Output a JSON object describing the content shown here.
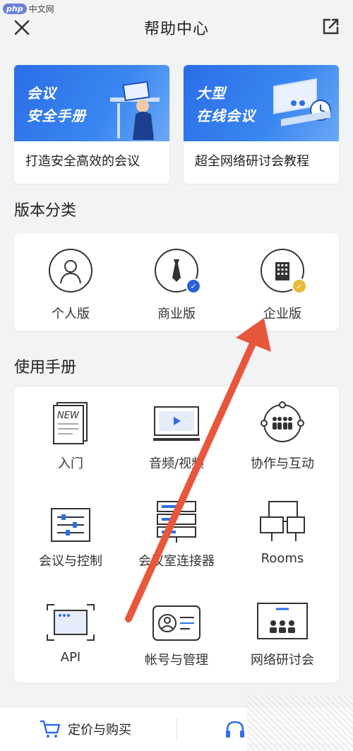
{
  "watermark": {
    "badge": "php",
    "text": "中文网"
  },
  "header": {
    "title": "帮助中心"
  },
  "banners": [
    {
      "line1": "会议",
      "line2": "安全手册",
      "caption": "打造安全高效的会议"
    },
    {
      "line1": "大型",
      "line2": "在线会议",
      "caption": "超全网络研讨会教程"
    }
  ],
  "editions_title": "版本分类",
  "editions": [
    {
      "label": "个人版",
      "icon": "person-icon"
    },
    {
      "label": "商业版",
      "icon": "tie-icon",
      "badge": "✓",
      "badge_color": "#2a62d6"
    },
    {
      "label": "企业版",
      "icon": "building-icon",
      "badge": "✓",
      "badge_color": "#e9b93a"
    }
  ],
  "manual_title": "使用手册",
  "manual": [
    {
      "label": "入门",
      "icon": "new-doc-icon"
    },
    {
      "label": "音频/视频",
      "icon": "monitor-play-icon"
    },
    {
      "label": "协作与互动",
      "icon": "people-circle-icon"
    },
    {
      "label": "会议与控制",
      "icon": "sliders-icon"
    },
    {
      "label": "会议室连接器",
      "icon": "server-rack-icon"
    },
    {
      "label": "Rooms",
      "icon": "rooms-icon"
    },
    {
      "label": "API",
      "icon": "api-screen-icon"
    },
    {
      "label": "帐号与管理",
      "icon": "id-card-icon"
    },
    {
      "label": "网络研讨会",
      "icon": "webinar-icon"
    }
  ],
  "bottom": {
    "buy_label": "定价与购买"
  },
  "colors": {
    "accent": "#2b6ee8",
    "arrow": "#e8563c"
  }
}
